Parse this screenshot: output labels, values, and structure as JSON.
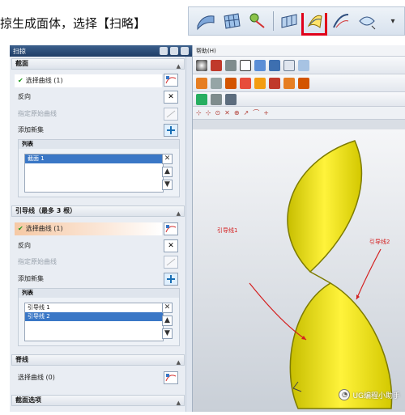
{
  "caption": {
    "text": "掠生成面体，选择【扫略】"
  },
  "toolbar_icons": [
    "surface-icon",
    "grid-surface-icon",
    "swept-tool-icon",
    "mesh-icon",
    "sweep-icon",
    "through-curves-icon",
    "law-curve-icon"
  ],
  "dialog": {
    "title": "扫掠",
    "section": {
      "label": "截面",
      "select_curve": "选择曲线 (1)",
      "reverse": "反向",
      "start_point": "指定原始曲线",
      "add_set": "添加新集",
      "list_header": "列表",
      "list_items": [
        "截面 1"
      ]
    },
    "guides": {
      "label": "引导线（最多 3 根）",
      "select_curve": "选择曲线 (1)",
      "reverse": "反向",
      "start_point": "指定原始曲线",
      "add_set": "添加新集",
      "list_header": "列表",
      "list_items": [
        "引导线 1",
        "引导线 2"
      ]
    },
    "spine": {
      "label": "脊线",
      "select_curve": "选择曲线 (0)"
    },
    "section_options": {
      "label": "截面选项"
    }
  },
  "app": {
    "menu": "帮助(H)",
    "annotations": {
      "guide1": "引导线1",
      "guide2": "引导线2"
    },
    "watermark": "UG编程小助手"
  },
  "colors": {
    "highlight": "#e0001a",
    "surface": "#f2ea1e",
    "selection": "#3a77c6"
  }
}
